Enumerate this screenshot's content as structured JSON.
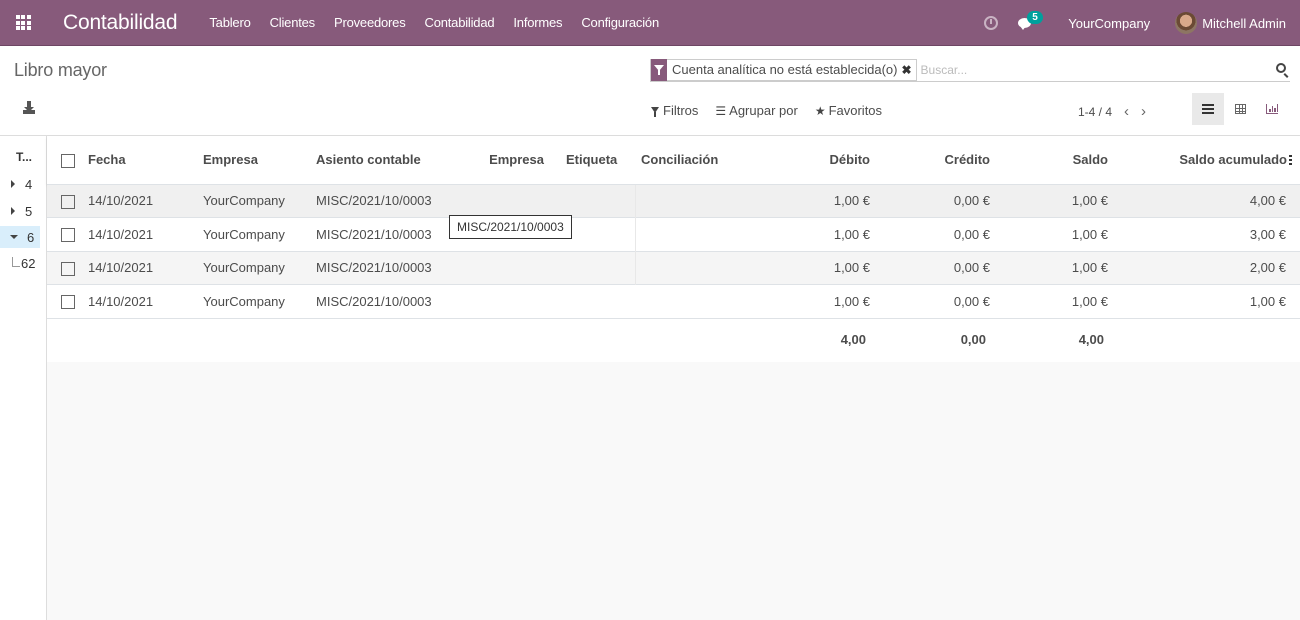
{
  "navbar": {
    "app_title": "Contabilidad",
    "menu": [
      "Tablero",
      "Clientes",
      "Proveedores",
      "Contabilidad",
      "Informes",
      "Configuración"
    ],
    "chat_badge": "5",
    "company": "YourCompany",
    "user": "Mitchell Admin"
  },
  "control_panel": {
    "breadcrumb": "Libro mayor",
    "search": {
      "facet": "Cuenta analítica no está establecida(o)",
      "placeholder": "Buscar..."
    },
    "filters_label": "Filtros",
    "groupby_label": "Agrupar por",
    "favorites_label": "Favoritos",
    "pager": "1-4 / 4"
  },
  "side_panel": {
    "header": "T...",
    "items": [
      {
        "label": "4",
        "expanded": false
      },
      {
        "label": "5",
        "expanded": false
      },
      {
        "label": "6",
        "expanded": true,
        "active": true
      }
    ],
    "child": "62"
  },
  "table": {
    "columns": [
      "Fecha",
      "Empresa",
      "Asiento contable",
      "Empresa",
      "Etiqueta",
      "Conciliación",
      "Débito",
      "Crédito",
      "Saldo",
      "Saldo acumulado"
    ],
    "rows": [
      {
        "fecha": "14/10/2021",
        "empresa": "YourCompany",
        "asiento": "MISC/2021/10/0003",
        "empresa2": "",
        "etiqueta": "",
        "conciliacion": "",
        "debito": "1,00 €",
        "credito": "0,00 €",
        "saldo": "1,00 €",
        "acumulado": "4,00 €"
      },
      {
        "fecha": "14/10/2021",
        "empresa": "YourCompany",
        "asiento": "MISC/2021/10/0003",
        "empresa2": "",
        "etiqueta": "",
        "conciliacion": "",
        "debito": "1,00 €",
        "credito": "0,00 €",
        "saldo": "1,00 €",
        "acumulado": "3,00 €"
      },
      {
        "fecha": "14/10/2021",
        "empresa": "YourCompany",
        "asiento": "MISC/2021/10/0003",
        "empresa2": "",
        "etiqueta": "",
        "conciliacion": "",
        "debito": "1,00 €",
        "credito": "0,00 €",
        "saldo": "1,00 €",
        "acumulado": "2,00 €"
      },
      {
        "fecha": "14/10/2021",
        "empresa": "YourCompany",
        "asiento": "MISC/2021/10/0003",
        "empresa2": "",
        "etiqueta": "",
        "conciliacion": "",
        "debito": "1,00 €",
        "credito": "0,00 €",
        "saldo": "1,00 €",
        "acumulado": "1,00 €"
      }
    ],
    "totals": {
      "debito": "4,00",
      "credito": "0,00",
      "saldo": "4,00"
    }
  },
  "tooltip": "MISC/2021/10/0003",
  "colors": {
    "brand": "#875a7b",
    "badge": "#00a09d",
    "active_side": "#d9eefb"
  }
}
